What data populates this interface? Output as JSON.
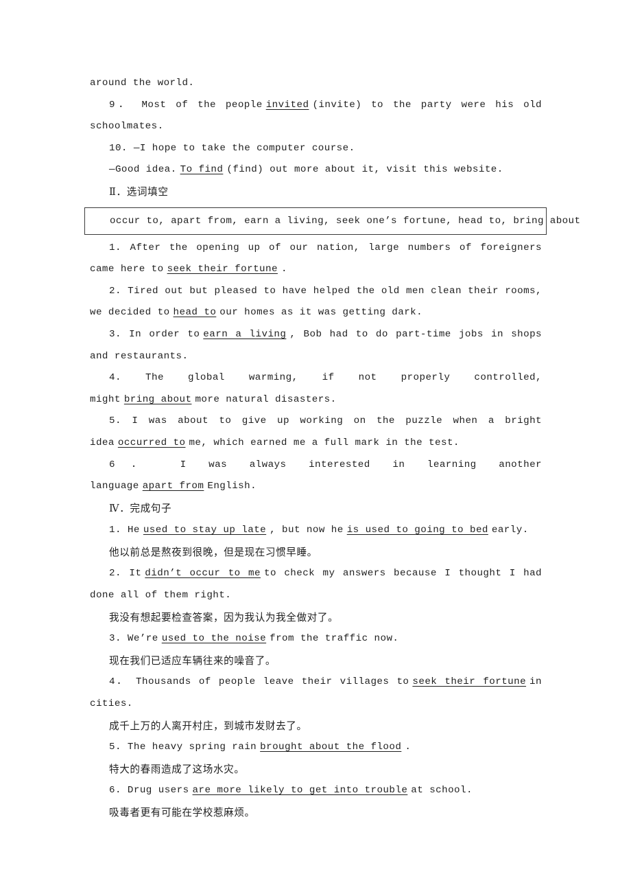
{
  "document": {
    "type": "english-exercise-worksheet",
    "language_mix": [
      "en",
      "zh-CN"
    ]
  },
  "continued_line": "around the world.",
  "section_grammar_fill": {
    "items": [
      {
        "number": "9．",
        "before": "Most of the people",
        "blank": "invited",
        "after": "(invite) to the party were his old schoolmates."
      },
      {
        "number": "10.",
        "prompt_line": "—I hope to take the computer course.",
        "answer_before": "—Good idea.",
        "blank": "To find",
        "answer_after": "(find) out more about it, visit this website."
      }
    ]
  },
  "section_word_choice": {
    "numeral": "Ⅱ",
    "dot": "．",
    "title": "选词填空",
    "word_bank": "occur to, apart from, earn a living, seek one’s fortune, head to, bring about",
    "items": [
      {
        "number": "1.",
        "before": "After the opening up of our nation, large numbers of foreigners came here to",
        "blank": "seek their fortune",
        "after": "."
      },
      {
        "number": "2.",
        "before": "Tired out but pleased to have helped the old men clean their rooms, we decided to",
        "blank": "head to",
        "after": "our homes as it was getting dark."
      },
      {
        "number": "3.",
        "before": "In order to",
        "blank": "earn a living",
        "after": ", Bob had to do part-time jobs in shops and restaurants."
      },
      {
        "number": "4.",
        "before": "The global warming, if not properly controlled, might",
        "blank": "bring about",
        "after": "more natural disasters."
      },
      {
        "number": "5.",
        "before": "I was about to give up working on the puzzle when a bright idea",
        "blank": "occurred to",
        "after": "me, which earned me a full mark in the test."
      },
      {
        "number": "6．",
        "before": "I was always interested in learning another language",
        "blank": "apart from",
        "after": "English."
      }
    ]
  },
  "section_complete_sentences": {
    "numeral": "Ⅳ",
    "dot": "．",
    "title": "完成句子",
    "items": [
      {
        "number": "1.",
        "seg1": "He",
        "blank1": "used to stay up late",
        "seg2": ", but now he",
        "blank2": "is used to going to bed",
        "seg3": "early.",
        "translation": "他以前总是熬夜到很晚，但是现在习惯早睡。"
      },
      {
        "number": "2.",
        "seg1": "It",
        "blank1": "didn’t occur to me",
        "seg2": "to check my answers because I thought I had done all of them right.",
        "translation": "我没有想起要检查答案，因为我认为我全做对了。"
      },
      {
        "number": "3.",
        "seg1": "We’re",
        "blank1": "used to the noise",
        "seg2": "from the traffic now.",
        "translation": "现在我们已适应车辆往来的噪音了。"
      },
      {
        "number": "4．",
        "seg1": "Thousands of people leave their villages to",
        "blank1": "seek their fortune",
        "seg2": "in cities.",
        "translation": "成千上万的人离开村庄，到城市发财去了。"
      },
      {
        "number": "5.",
        "seg1": "The heavy spring rain",
        "blank1": "brought about the flood",
        "seg2": ".",
        "translation": "特大的春雨造成了这场水灾。"
      },
      {
        "number": "6.",
        "seg1": "Drug users",
        "blank1": "are more likely to get into trouble",
        "seg2": "at school.",
        "translation": "吸毒者更有可能在学校惹麻烦。"
      }
    ]
  }
}
